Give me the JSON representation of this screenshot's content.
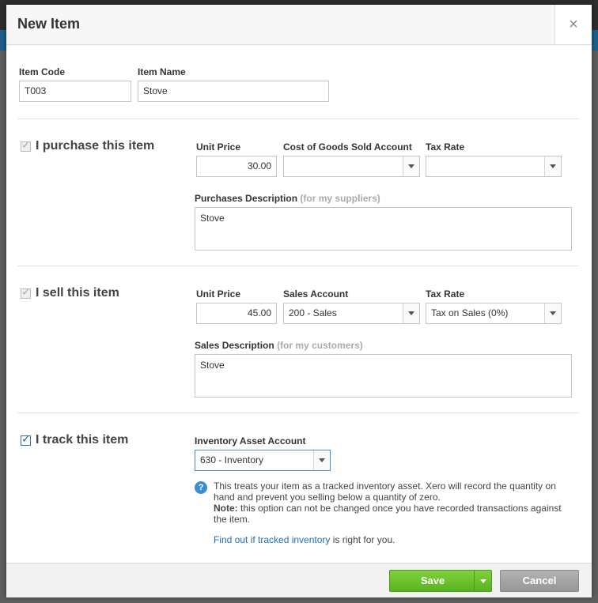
{
  "dialog": {
    "title": "New Item",
    "close_symbol": "×"
  },
  "item": {
    "code_label": "Item Code",
    "code_value": "T003",
    "name_label": "Item Name",
    "name_value": "Stove"
  },
  "purchase": {
    "checkbox_label": "I purchase this item",
    "checked": true,
    "unit_price_label": "Unit Price",
    "unit_price_value": "30.00",
    "account_label": "Cost of Goods Sold Account",
    "account_value": "",
    "tax_rate_label": "Tax Rate",
    "tax_rate_value": "",
    "description_label": "Purchases Description",
    "description_hint": "(for my suppliers)",
    "description_value": "Stove"
  },
  "sell": {
    "checkbox_label": "I sell this item",
    "checked": true,
    "unit_price_label": "Unit Price",
    "unit_price_value": "45.00",
    "account_label": "Sales Account",
    "account_value": "200 - Sales",
    "tax_rate_label": "Tax Rate",
    "tax_rate_value": "Tax on Sales (0%)",
    "description_label": "Sales Description",
    "description_hint": "(for my customers)",
    "description_value": "Stove"
  },
  "track": {
    "checkbox_label": "I track this item",
    "checked": true,
    "account_label": "Inventory Asset Account",
    "account_value": "630 - Inventory",
    "info_icon": "?",
    "info_line1": "This treats your item as a tracked inventory asset. Xero will record the quantity on hand and prevent you selling below a quantity of zero.",
    "note_label": "Note:",
    "note_text": "this option can not be changed once you have recorded transactions against the item.",
    "link_text": "Find out if tracked inventory",
    "link_suffix": "is right for you."
  },
  "footer": {
    "save_label": "Save",
    "cancel_label": "Cancel"
  },
  "colors": {
    "save_green": "#5bb321",
    "link_blue": "#1f6fb0",
    "info_blue": "#3b8fd0"
  }
}
